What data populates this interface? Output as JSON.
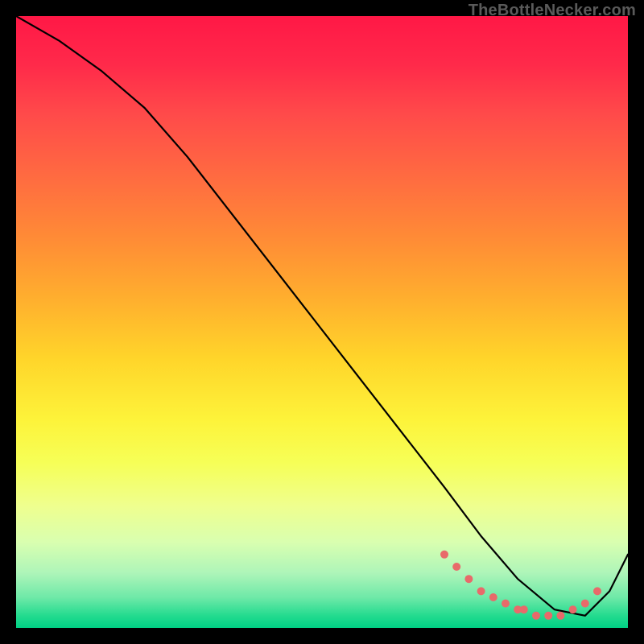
{
  "watermark": "TheBottleNecker.com",
  "chart_data": {
    "type": "line",
    "title": "",
    "xlabel": "",
    "ylabel": "",
    "xlim": [
      0,
      100
    ],
    "ylim": [
      0,
      100
    ],
    "grid": false,
    "series": [
      {
        "name": "curve",
        "x": [
          0,
          7,
          14,
          21,
          28,
          35,
          42,
          49,
          56,
          63,
          70,
          76,
          82,
          88,
          93,
          97,
          100
        ],
        "values": [
          100,
          96,
          91,
          85,
          77,
          68,
          59,
          50,
          41,
          32,
          23,
          15,
          8,
          3,
          2,
          6,
          12
        ]
      }
    ],
    "markers": {
      "name": "dots",
      "color": "#e86a6a",
      "x": [
        70,
        72,
        74,
        76,
        78,
        80,
        82,
        83,
        85,
        87,
        89,
        91,
        93,
        95
      ],
      "values": [
        12,
        10,
        8,
        6,
        5,
        4,
        3,
        3,
        2,
        2,
        2,
        3,
        4,
        6
      ]
    }
  }
}
